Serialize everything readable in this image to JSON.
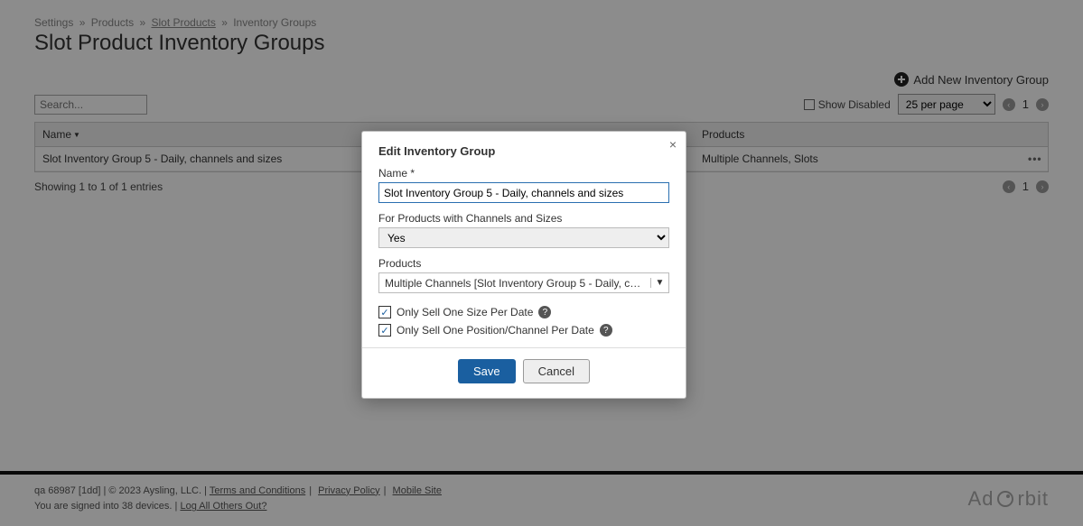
{
  "breadcrumbs": {
    "settings": "Settings",
    "products": "Products",
    "slot_products": "Slot Products",
    "inventory_groups": "Inventory Groups"
  },
  "page_title": "Slot Product Inventory Groups",
  "add_new": "Add New Inventory Group",
  "search": {
    "placeholder": "Search..."
  },
  "show_disabled": "Show Disabled",
  "per_page": "25 per page",
  "page_num": "1",
  "table": {
    "col_name": "Name",
    "col_products": "Products",
    "rows": [
      {
        "name": "Slot Inventory Group 5 - Daily, channels and sizes",
        "products": "Multiple Channels, Slots"
      }
    ]
  },
  "showing": "Showing 1 to 1 of 1 entries",
  "modal": {
    "title": "Edit Inventory Group",
    "name_label": "Name *",
    "name_value": "Slot Inventory Group 5 - Daily, channels and sizes",
    "for_products_label": "For Products with Channels and Sizes",
    "for_products_value": "Yes",
    "products_label": "Products",
    "products_value": "Multiple Channels [Slot Inventory Group 5 - Daily, channels…",
    "only_size": "Only Sell One Size Per Date",
    "only_pos": "Only Sell One Position/Channel Per Date",
    "save": "Save",
    "cancel": "Cancel"
  },
  "footer": {
    "line1_pre": "qa 68987 [1dd] | © 2023 Aysling, LLC. | ",
    "terms": "Terms and Conditions",
    "privacy": "Privacy Policy",
    "mobile": "Mobile Site",
    "line2_pre": "You are signed into 38 devices. | ",
    "logout": "Log All Others Out?",
    "brand1": "Ad",
    "brand2": "rbit"
  }
}
